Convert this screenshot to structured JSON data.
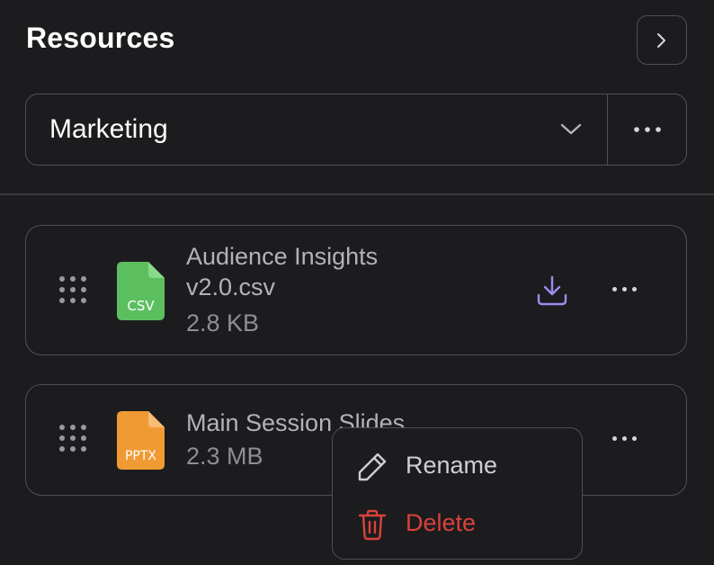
{
  "header": {
    "title": "Resources"
  },
  "folder_selector": {
    "value": "Marketing"
  },
  "files": [
    {
      "name_line1": "Audience Insights",
      "name_line2": "v2.0.csv",
      "size": "2.8 KB",
      "type_label": "CSV",
      "icon_color": "#5cbf5f",
      "icon": "file-csv-icon"
    },
    {
      "name_line1": "Main Session Slides",
      "size": "2.3 MB",
      "type_label": "PPTX",
      "icon_color": "#f09a33",
      "icon": "file-pptx-icon"
    }
  ],
  "context_menu": {
    "items": [
      {
        "label": "Rename",
        "icon": "pencil-icon"
      },
      {
        "label": "Delete",
        "icon": "trash-icon",
        "color": "#d9423a"
      }
    ]
  },
  "colors": {
    "background": "#1c1c1e",
    "border": "#505053",
    "accent": "#9b8cf0",
    "danger": "#d9423a"
  }
}
